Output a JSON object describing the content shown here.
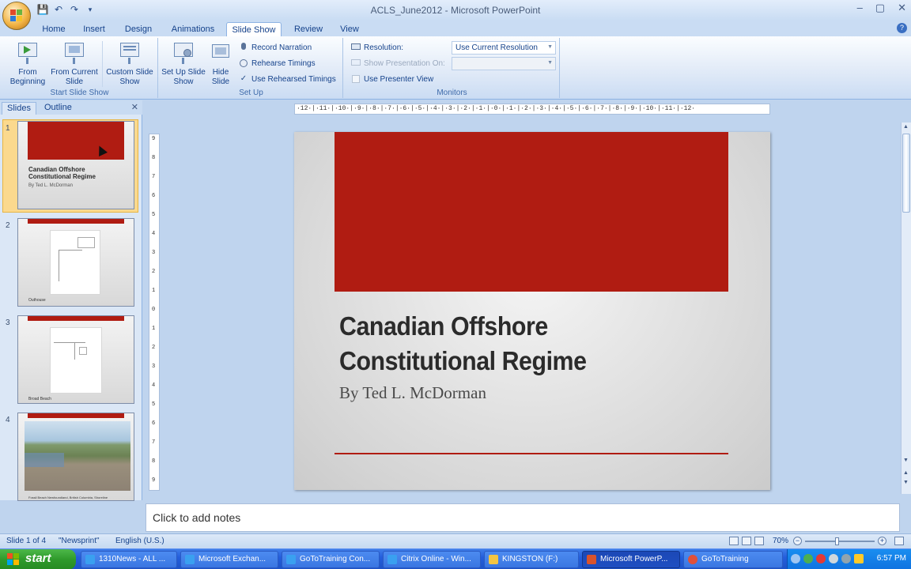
{
  "window": {
    "title": "ACLS_June2012 - Microsoft PowerPoint"
  },
  "ribbon_tabs": [
    "Home",
    "Insert",
    "Design",
    "Animations",
    "Slide Show",
    "Review",
    "View"
  ],
  "ribbon": {
    "start_group": {
      "label": "Start Slide Show",
      "from_beginning": "From Beginning",
      "from_current": "From Current Slide",
      "custom": "Custom Slide Show"
    },
    "setup_group": {
      "label": "Set Up",
      "setup_show": "Set Up Slide Show",
      "hide_slide": "Hide Slide",
      "record_narration": "Record Narration",
      "rehearse_timings": "Rehearse Timings",
      "use_rehearsed_timings": "Use Rehearsed Timings",
      "use_rehearsed_checked": true
    },
    "monitors_group": {
      "label": "Monitors",
      "resolution_label": "Resolution:",
      "resolution_value": "Use Current Resolution",
      "show_on_label": "Show Presentation On:",
      "show_on_value": "",
      "presenter_view": "Use Presenter View"
    }
  },
  "left_panel": {
    "tabs": [
      "Slides",
      "Outline"
    ],
    "active_tab": "Slides",
    "thumbnails": [
      {
        "num": "1",
        "title": "Canadian Offshore Constitutional Regime",
        "subtitle": "By Ted L. McDorman",
        "selected": true
      },
      {
        "num": "2",
        "caption": "Outhouse",
        "selected": false
      },
      {
        "num": "3",
        "caption": "Broad Beach",
        "selected": false
      },
      {
        "num": "4",
        "caption": "Fossil Beach Newfoundland, British Columbia, Shoreline",
        "selected": false
      }
    ]
  },
  "ruler": {
    "horizontal": "·12·|·11·|·10·|·9·|·8·|·7·|·6·|·5·|·4·|·3·|·2·|·1·|·0·|·1·|·2·|·3·|·4·|·5·|·6·|·7·|·8·|·9·|·10·|·11·|·12·",
    "vertical_ticks": [
      "9",
      "8",
      "7",
      "6",
      "5",
      "4",
      "3",
      "2",
      "1",
      "0",
      "1",
      "2",
      "3",
      "4",
      "5",
      "6",
      "7",
      "8",
      "9"
    ]
  },
  "slide": {
    "title_line1": "Canadian Offshore",
    "title_line2": "Constitutional Regime",
    "subtitle": "By Ted L. McDorman",
    "accent_color": "#b01c12"
  },
  "notes": {
    "placeholder": "Click to add notes"
  },
  "status_bar": {
    "slide_info": "Slide 1 of 4",
    "theme": "\"Newsprint\"",
    "language": "English (U.S.)",
    "zoom": "70%",
    "zoom_level_percent": 70
  },
  "taskbar": {
    "start": "start",
    "tasks": [
      {
        "label": "1310News - ALL ...",
        "icon_color": "#3aa0f0",
        "active": false
      },
      {
        "label": "Microsoft Exchan...",
        "icon_color": "#3aa0f0",
        "active": false
      },
      {
        "label": "GoToTraining Con...",
        "icon_color": "#3aa0f0",
        "active": false
      },
      {
        "label": "Citrix Online - Win...",
        "icon_color": "#3aa0f0",
        "active": false
      },
      {
        "label": "KINGSTON (F:)",
        "icon_color": "#f4c542",
        "active": false
      },
      {
        "label": "Microsoft PowerP...",
        "icon_color": "#d9532c",
        "active": true
      },
      {
        "label": "GoToTraining",
        "icon_color": "#e0503a",
        "active": false
      }
    ],
    "clock": "6:57 PM"
  }
}
